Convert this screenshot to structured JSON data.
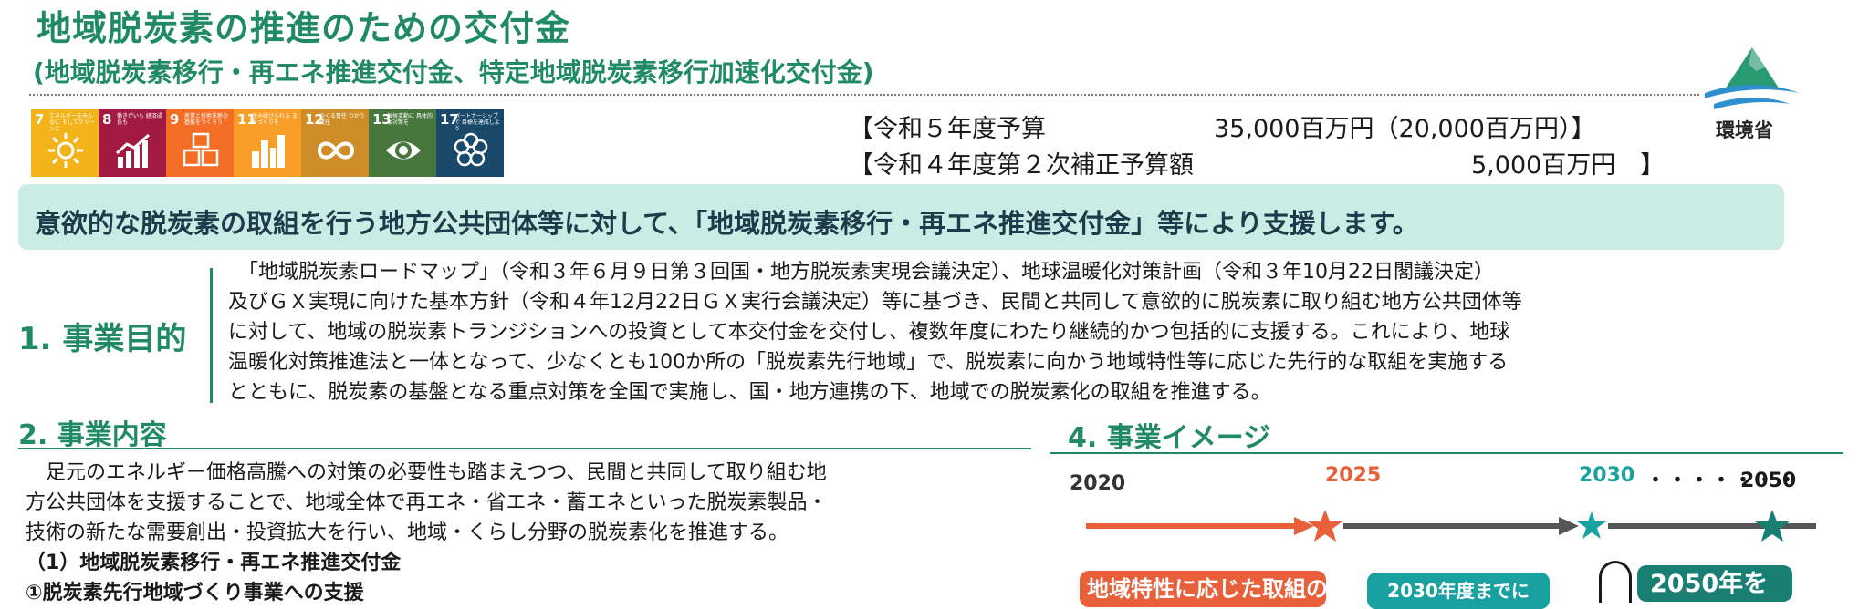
{
  "header": {
    "title": "地域脱炭素の推進のための交付金",
    "subtitle": "(地域脱炭素移行・再エネ推進交付金、特定地域脱炭素移行加速化交付金)",
    "ministry": "環境省"
  },
  "sdgs": [
    {
      "num": "7",
      "caption": "エネルギーをみんなに そしてクリーンに",
      "color": "#f3b31b",
      "icon": "sun-icon"
    },
    {
      "num": "8",
      "caption": "働きがいも 経済成長も",
      "color": "#a21942",
      "icon": "growth-chart-icon"
    },
    {
      "num": "9",
      "caption": "産業と技術革新の 基盤をつくろう",
      "color": "#f36d25",
      "icon": "cubes-icon"
    },
    {
      "num": "11",
      "caption": "住み続けられる まちづくりを",
      "color": "#f99d26",
      "icon": "city-icon"
    },
    {
      "num": "12",
      "caption": "つくる責任 つかう責任",
      "color": "#cf8d2a",
      "icon": "infinity-icon"
    },
    {
      "num": "13",
      "caption": "気候変動に 具体的な対策を",
      "color": "#48773e",
      "icon": "eye-globe-icon"
    },
    {
      "num": "17",
      "caption": "パートナーシップで 目標を達成しよう",
      "color": "#19486a",
      "icon": "flower-icon"
    }
  ],
  "budget": {
    "line1_label": "【令和５年度予算",
    "line1_value": "35,000百万円（20,000百万円）】",
    "line2_label": "【令和４年度第２次補正予算額",
    "line2_value": "5,000百万円　】"
  },
  "banner": {
    "text": "意欲的な脱炭素の取組を行う地方公共団体等に対して、「地域脱炭素移行・再エネ推進交付金」等により支援します。"
  },
  "section1": {
    "heading": "1. 事業目的",
    "lines": [
      "　「地域脱炭素ロードマップ」（令和３年６月９日第３回国・地方脱炭素実現会議決定）、地球温暖化対策計画（令和３年10月22日閣議決定）",
      "及びＧＸ実現に向けた基本方針（令和４年12月22日ＧＸ実行会議決定）等に基づき、民間と共同して意欲的に脱炭素に取り組む地方公共団体等",
      "に対して、地域の脱炭素トランジションへの投資として本交付金を交付し、複数年度にわたり継続的かつ包括的に支援する。これにより、地球",
      "温暖化対策推進法と一体となって、少なくとも100か所の「脱炭素先行地域」で、脱炭素に向かう地域特性等に応じた先行的な取組を実施する",
      "とともに、脱炭素の基盤となる重点対策を全国で実施し、国・地方連携の下、地域での脱炭素化の取組を推進する。"
    ]
  },
  "section2": {
    "heading": "2. 事業内容",
    "lines": [
      "　足元のエネルギー価格高騰への対策の必要性も踏まえつつ、民間と共同して取り組む地",
      "方公共団体を支援することで、地域全体で再エネ・省エネ・蓄エネといった脱炭素製品・",
      "技術の新たな需要創出・投資拡大を行い、地域・くらし分野の脱炭素化を推進する。"
    ],
    "sub1": "（1）地域脱炭素移行・再エネ推進交付金",
    "sub2": "①脱炭素先行地域づくり事業への支援"
  },
  "section4": {
    "heading": "4. 事業イメージ",
    "years": {
      "y2020": "2020",
      "y2025": "2025",
      "y2030": "2030",
      "dots": "・・・・・・・",
      "y2050": "2050"
    },
    "tagA": "地域特性に応じた取組の",
    "tagB": "2030年度までに",
    "tagC": "2050年を"
  },
  "colors": {
    "brand_green": "#1f8a63",
    "banner_bg": "#c9ede5",
    "orange": "#e8603a",
    "teal": "#19a1a1",
    "dark_teal": "#1a7f73"
  }
}
